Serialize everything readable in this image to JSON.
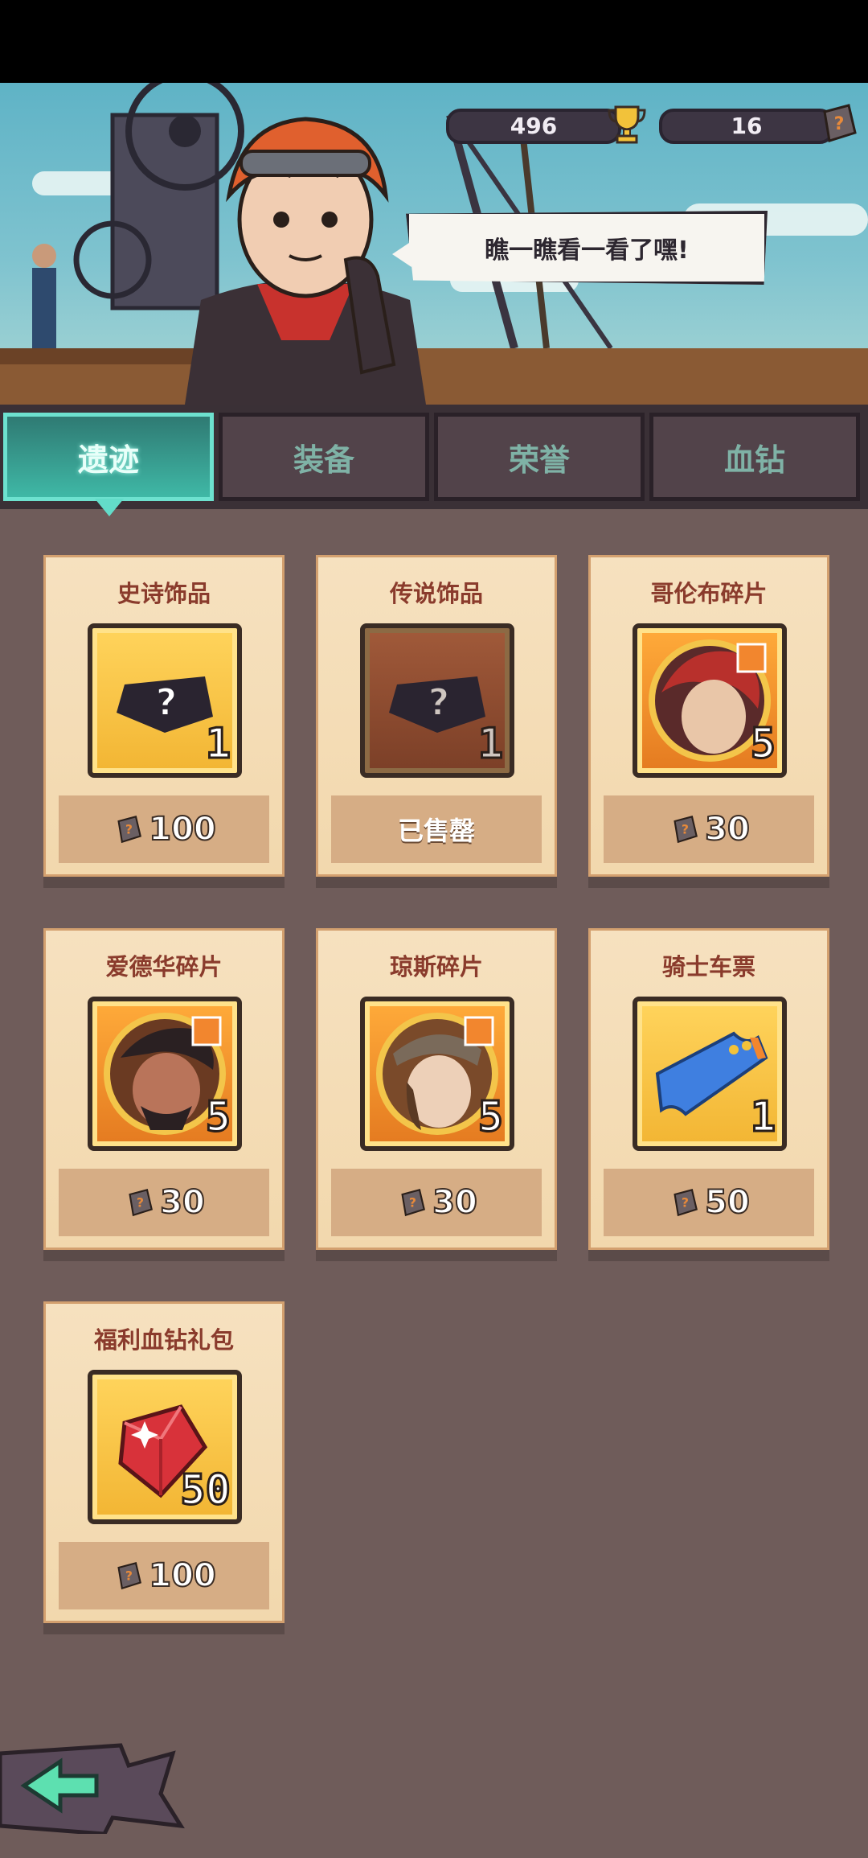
{
  "resources": {
    "trophies": "496",
    "relic_coins": "16"
  },
  "npc": {
    "speech": "瞧一瞧看一看了嘿!"
  },
  "tabs": [
    {
      "label": "遗迹",
      "active": true
    },
    {
      "label": "装备",
      "active": false
    },
    {
      "label": "荣誉",
      "active": false
    },
    {
      "label": "血钻",
      "active": false
    }
  ],
  "items": [
    {
      "title": "史诗饰品",
      "qty": "1",
      "price": "100",
      "icon": "mystery-accessory-icon"
    },
    {
      "title": "传说饰品",
      "qty": "1",
      "price": "已售罄",
      "icon": "mystery-accessory-icon",
      "sold_out": true
    },
    {
      "title": "哥伦布碎片",
      "qty": "5",
      "price": "30",
      "icon": "hero-portrait-icon"
    },
    {
      "title": "爱德华碎片",
      "qty": "5",
      "price": "30",
      "icon": "hero-portrait-icon"
    },
    {
      "title": "琼斯碎片",
      "qty": "5",
      "price": "30",
      "icon": "hero-portrait-icon"
    },
    {
      "title": "骑士车票",
      "qty": "1",
      "price": "50",
      "icon": "ticket-icon"
    },
    {
      "title": "福利血钻礼包",
      "qty": "50",
      "price": "100",
      "icon": "red-diamond-icon"
    }
  ],
  "colors": {
    "active_tab": "#3fb8a6",
    "card": "#f2d8ad",
    "background": "#6f5c5a"
  }
}
